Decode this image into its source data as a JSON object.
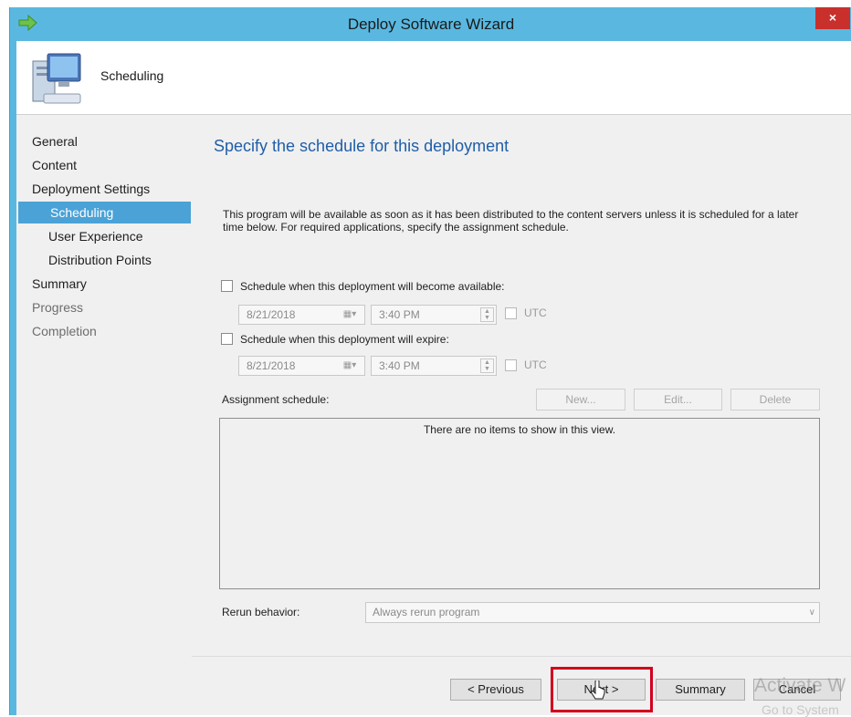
{
  "window": {
    "title": "Deploy Software Wizard",
    "close_glyph": "×",
    "app_icon": "green-arrow-icon"
  },
  "banner": {
    "title": "Scheduling",
    "icon": "computer-icon"
  },
  "sidebar": {
    "items": [
      {
        "label": "General",
        "level": 0,
        "state": "normal"
      },
      {
        "label": "Content",
        "level": 0,
        "state": "normal"
      },
      {
        "label": "Deployment Settings",
        "level": 0,
        "state": "normal"
      },
      {
        "label": "Scheduling",
        "level": 1,
        "state": "selected"
      },
      {
        "label": "User Experience",
        "level": 1,
        "state": "normal"
      },
      {
        "label": "Distribution Points",
        "level": 1,
        "state": "normal"
      },
      {
        "label": "Summary",
        "level": 0,
        "state": "normal"
      },
      {
        "label": "Progress",
        "level": 0,
        "state": "disabled"
      },
      {
        "label": "Completion",
        "level": 0,
        "state": "disabled"
      }
    ]
  },
  "main": {
    "heading": "Specify the schedule for this deployment",
    "description": "This program will be available as soon as it has been distributed to the content servers unless it is scheduled for a later time below. For required applications, specify the assignment schedule.",
    "available": {
      "checkbox_label": "Schedule when this deployment will become available:",
      "checked": false,
      "date": "8/21/2018",
      "time": "3:40 PM",
      "utc_label": "UTC"
    },
    "expire": {
      "checkbox_label": "Schedule when this deployment will expire:",
      "checked": false,
      "date": "8/21/2018",
      "time": "3:40 PM",
      "utc_label": "UTC"
    },
    "assignment": {
      "label": "Assignment schedule:",
      "new_label": "New...",
      "edit_label": "Edit...",
      "delete_label": "Delete",
      "empty_text": "There are no items to show in this view."
    },
    "rerun": {
      "label": "Rerun behavior:",
      "value": "Always rerun program"
    }
  },
  "footer": {
    "previous_label": "< Previous",
    "next_label": "Next >",
    "summary_label": "Summary",
    "cancel_label": "Cancel"
  },
  "overlay": {
    "watermark_line1": "Activate W",
    "watermark_line2": "Go to System",
    "highlight_color": "#d2001e"
  }
}
